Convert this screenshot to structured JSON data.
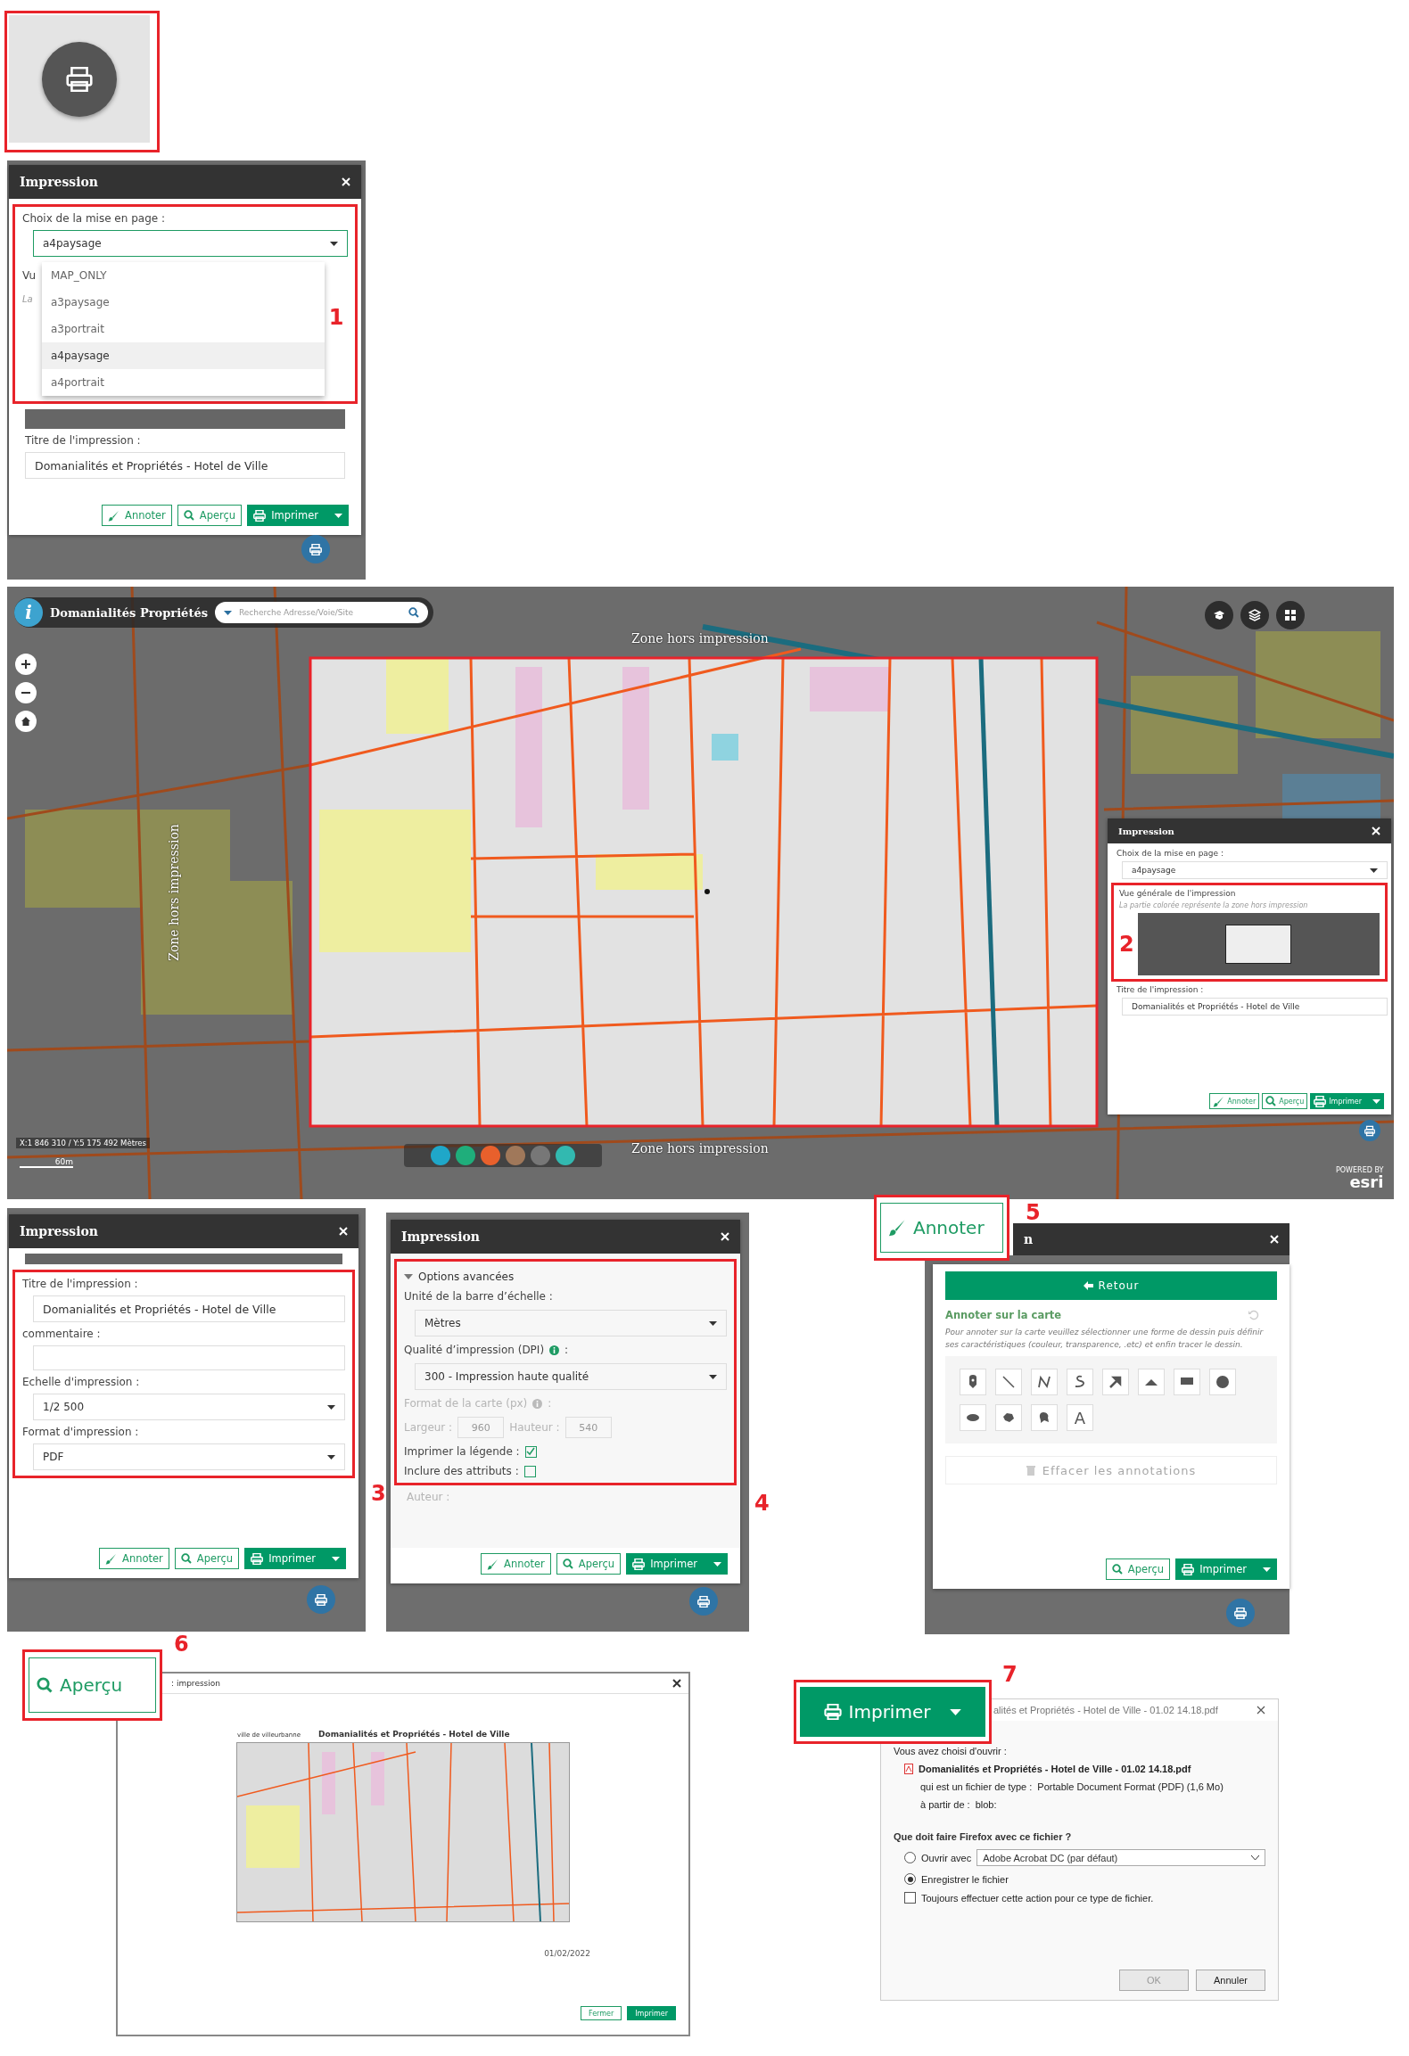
{
  "layout_panel": {
    "title": "Impression",
    "callout": "1",
    "layout_label": "Choix de la mise en page :",
    "layout_value": "a4paysage",
    "options": [
      {
        "label": "MAP_ONLY",
        "selected": false
      },
      {
        "label": "a3paysage",
        "selected": false
      },
      {
        "label": "a3portrait",
        "selected": false
      },
      {
        "label": "a4paysage",
        "selected": true
      },
      {
        "label": "a4portrait",
        "selected": false
      }
    ],
    "hidden_label": "Vu",
    "hidden_hint": "La",
    "title_label": "Titre de l'impression :",
    "title_value": "Domanialités et Propriétés - Hotel de Ville",
    "buttons": [
      {
        "kind": "annotate",
        "label": "Annoter"
      },
      {
        "kind": "preview",
        "label": "Aperçu"
      },
      {
        "kind": "print",
        "label": "Imprimer"
      }
    ]
  },
  "map": {
    "info_label": "i",
    "app_title": "Domanialités Propriétés",
    "search_placeholder": "Recherche Adresse/Voie/Site",
    "zone_labels": [
      "Zone hors impression",
      "Zone hors impression",
      "Zone hors impression"
    ],
    "coordinates": "X:1 846 310 / Y:5 175 492 Mètres",
    "scale": "60m",
    "attribution_small": "POWERED BY",
    "attribution": "esri",
    "panel": {
      "title": "Impression",
      "callout": "2",
      "layout_label": "Choix de la mise en page :",
      "layout_value": "a4paysage",
      "overview_label": "Vue générale de l'impression",
      "overview_hint": "La partie colorée représente la zone hors impression",
      "title_label": "Titre de l'impression :",
      "title_value": "Domanialités et Propriétés - Hotel de Ville",
      "buttons": [
        {
          "kind": "annotate",
          "label": "Annoter"
        },
        {
          "kind": "preview",
          "label": "Aperçu"
        },
        {
          "kind": "print",
          "label": "Imprimer"
        }
      ]
    }
  },
  "options_panel": {
    "title": "Impression",
    "callout": "3",
    "title_label": "Titre de l'impression :",
    "title_value": "Domanialités et Propriétés - Hotel de Ville",
    "comment_label": "commentaire :",
    "scale_label": "Echelle d'impression :",
    "scale_value": "1/2 500",
    "format_label": "Format d'impression :",
    "format_value": "PDF",
    "buttons": [
      {
        "kind": "annotate",
        "label": "Annoter"
      },
      {
        "kind": "preview",
        "label": "Aperçu"
      },
      {
        "kind": "print",
        "label": "Imprimer"
      }
    ]
  },
  "advanced_panel": {
    "title": "Impression",
    "callout": "4",
    "section_label": "Options avancées",
    "expanded": true,
    "unit_label": "Unité de la barre d’échelle :",
    "unit_value": "Mètres",
    "dpi_label": "Qualité d’impression (DPI)",
    "dpi_colon": ":",
    "dpi_value": "300 - Impression haute qualité",
    "size_label": "Format de la carte (px)",
    "size_colon": ":",
    "size_disabled": true,
    "width_label": "Largeur :",
    "width_value": "960",
    "height_label": "Hauteur :",
    "height_value": "540",
    "legend_label": "Imprimer la légende :",
    "legend_checked": true,
    "attributes_label": "Inclure des attributs :",
    "attributes_checked": false,
    "author_label": "Auteur :",
    "buttons": [
      {
        "kind": "annotate",
        "label": "Annoter"
      },
      {
        "kind": "preview",
        "label": "Aperçu"
      },
      {
        "kind": "print",
        "label": "Imprimer"
      }
    ]
  },
  "annotate_panel": {
    "callout": "5",
    "highlight_button": "Annoter",
    "title": "n",
    "back_button": "Retour",
    "heading": "Annoter sur la carte",
    "instructions": "Pour annoter sur la carte veuillez sélectionner une forme de dessin puis définir ses caractéristiques (couleur, transparence, .etc) et enfin tracer le dessin.",
    "tools": [
      {
        "kind": "marker"
      },
      {
        "kind": "line"
      },
      {
        "kind": "polyline"
      },
      {
        "kind": "freehand"
      },
      {
        "kind": "arrow"
      },
      {
        "kind": "triangle"
      },
      {
        "kind": "rectangle"
      },
      {
        "kind": "circle"
      },
      {
        "kind": "ellipse"
      },
      {
        "kind": "polygon"
      },
      {
        "kind": "freehand-polygon"
      },
      {
        "kind": "text",
        "label": "A"
      }
    ],
    "clear_button": "Effacer les annotations",
    "clear_disabled": true,
    "buttons": [
      {
        "kind": "preview",
        "label": "Aperçu"
      },
      {
        "kind": "print",
        "label": "Imprimer"
      }
    ]
  },
  "preview": {
    "callout": "6",
    "highlight_button": "Aperçu",
    "dialog_title": ": impression",
    "logo": "ville de villeurbanne",
    "doc_title": "Domanialités et Propriétés - Hotel de Ville",
    "date": "01/02/2022",
    "buttons": [
      {
        "kind": "close",
        "label": "Fermer"
      },
      {
        "kind": "print",
        "label": "Imprimer"
      }
    ]
  },
  "download": {
    "callout": "7",
    "highlight_button": "Imprimer",
    "dialog_title": "alités et Propriétés - Hotel de Ville - 01.02 14.18.pdf",
    "chosen_label": "Vous avez choisi d'ouvrir :",
    "filename": "Domanialités et Propriétés - Hotel de Ville - 01.02 14.18.pdf",
    "type_label": "qui est un fichier de type :",
    "type_value": "Portable Document Format (PDF) (1,6 Mo)",
    "source_label": "à partir de :",
    "source_value": "blob:",
    "question": "Que doit faire Firefox avec ce fichier ?",
    "actions": [
      {
        "label": "Ouvrir avec",
        "selected": false,
        "app": "Adobe Acrobat DC (par défaut)"
      },
      {
        "label": "Enregistrer le fichier",
        "selected": true
      }
    ],
    "always_label": "Toujours effectuer cette action pour ce type de fichier.",
    "always_checked": false,
    "ok_button": "OK",
    "ok_disabled": true,
    "cancel_button": "Annuler"
  }
}
